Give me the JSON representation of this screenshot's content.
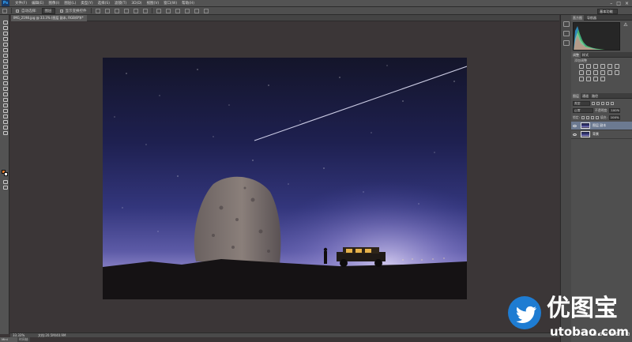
{
  "app": {
    "logo": "Ps"
  },
  "menu": [
    "文件(F)",
    "编辑(E)",
    "图像(I)",
    "图层(L)",
    "类型(Y)",
    "选择(S)",
    "滤镜(T)",
    "3D(D)",
    "视图(V)",
    "窗口(W)",
    "帮助(H)"
  ],
  "window_controls": [
    "–",
    "□",
    "×"
  ],
  "options": {
    "auto_select_label": "自动选择:",
    "auto_select_value": "图层",
    "show_transform": "显示变换控件"
  },
  "workspace": {
    "current": "基本功能"
  },
  "document": {
    "tab_title": "IMG_2198.jpg @ 33.3% (图层 副本, RGB/8*) *",
    "close": "×"
  },
  "status": {
    "zoom": "33.33%",
    "doc_info": "文档:20.5M/40.9M"
  },
  "bottom_tabs": [
    "Mini Bridge",
    "时间轴"
  ],
  "panels": {
    "histogram_tabs": [
      "直方图",
      "导航器"
    ],
    "adjustments_tabs": [
      "调整",
      "样式"
    ],
    "adjustments_title": "添加调整",
    "layers_tabs": [
      "图层",
      "通道",
      "路径"
    ],
    "kind_filter": "类型",
    "blend_mode": "正常",
    "opacity_label": "不透明度:",
    "opacity_value": "100%",
    "lock_label": "锁定:",
    "fill_label": "填充:",
    "fill_value": "100%",
    "layers": [
      {
        "name": "图层 副本",
        "selected": true
      },
      {
        "name": "背景",
        "selected": false
      }
    ]
  },
  "watermark": {
    "brand": "优图宝",
    "url": "utobao.com"
  },
  "colors": {
    "foreground": "#e07a2a",
    "background": "#f2f2f2",
    "watermark_blue": "#1e7cd2"
  },
  "icons": [
    "ps-logo-icon",
    "move-tool-icon",
    "marquee-tool-icon",
    "lasso-tool-icon",
    "eye-icon",
    "twitter-bird-icon",
    "histogram-warning-icon"
  ]
}
